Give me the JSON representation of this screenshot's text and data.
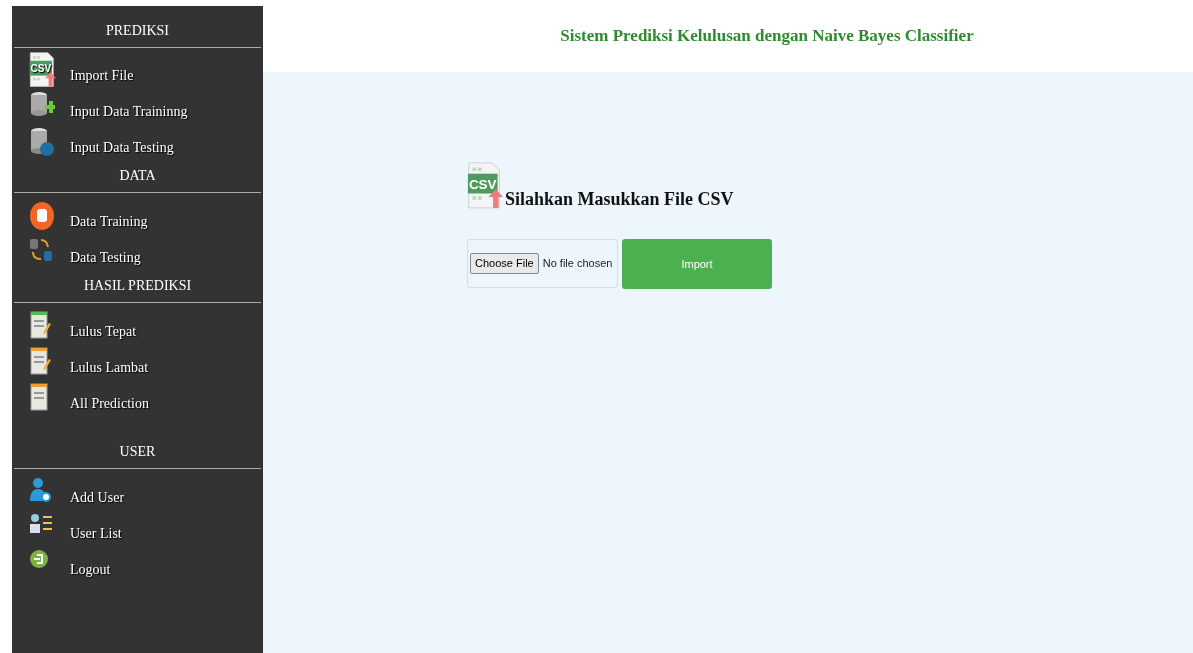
{
  "sidebar": {
    "sections": [
      {
        "title": "PREDIKSI",
        "items": [
          {
            "label": "Import File",
            "kind": "csv",
            "icon_text": "CSV"
          },
          {
            "label": "Input Data Traininng",
            "kind": "db-add"
          },
          {
            "label": "Input Data Testing",
            "kind": "db-globe"
          }
        ]
      },
      {
        "title": "DATA",
        "items": [
          {
            "label": "Data Training",
            "kind": "db-orange"
          },
          {
            "label": "Data Testing",
            "kind": "db-sync"
          }
        ]
      },
      {
        "title": "HASIL PREDIKSI",
        "items": [
          {
            "label": "Lulus Tepat",
            "kind": "doc-edit"
          },
          {
            "label": "Lulus Lambat",
            "kind": "doc-chart"
          },
          {
            "label": "All Prediction",
            "kind": "doc"
          }
        ]
      },
      {
        "title": "USER",
        "items": [
          {
            "label": "Add User",
            "kind": "user-add"
          },
          {
            "label": "User List",
            "kind": "user-list"
          },
          {
            "label": "Logout",
            "kind": "logout"
          }
        ]
      }
    ]
  },
  "header": {
    "title": "Sistem Prediksi Kelulusan dengan Naive Bayes Classifier"
  },
  "upload": {
    "icon_text": "CSV",
    "heading": "Silahkan Masukkan File CSV",
    "choose_button": "Choose File",
    "file_status": "No file chosen",
    "import_button": "Import"
  }
}
